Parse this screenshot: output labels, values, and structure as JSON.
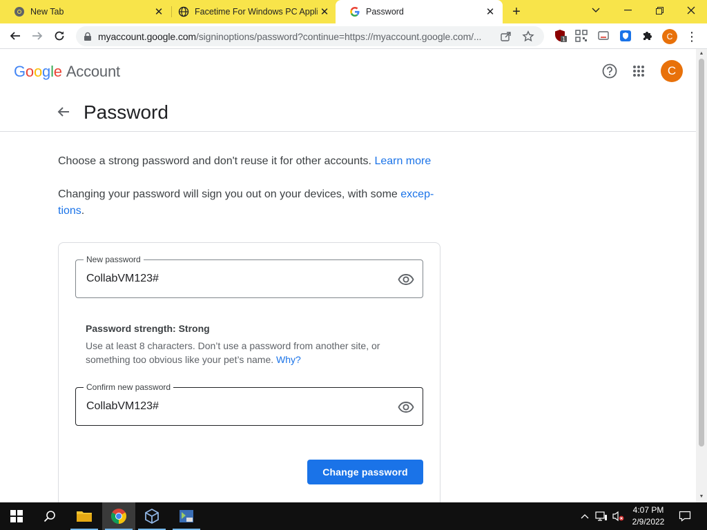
{
  "tabs": [
    {
      "title": "New Tab"
    },
    {
      "title": "Facetime For Windows PC Applic"
    },
    {
      "title": "Password"
    }
  ],
  "address_bar": {
    "host": "myaccount.google.com",
    "path": "/signinoptions/password?continue=https://myaccount.google.com/..."
  },
  "header": {
    "logo_letters": [
      "G",
      "o",
      "o",
      "g",
      "l",
      "e"
    ],
    "product": "Account",
    "avatar_letter": "C"
  },
  "page": {
    "title": "Password",
    "intro": "Choose a strong password and don't reuse it for other accounts.",
    "learn_more": "Learn more",
    "signout_note": "Changing your password will sign you out on your devices, with some",
    "exceptions_link_1": "excep-",
    "exceptions_link_2": "tions",
    "period": "."
  },
  "form": {
    "new_password_label": "New password",
    "new_password_value": "CollabVM123#",
    "strength_title": "Password strength: Strong",
    "strength_help": "Use at least 8 characters. Don’t use a password from another site, or something too obvious like your pet’s name.",
    "why_link": "Why?",
    "confirm_label": "Confirm new password",
    "confirm_value": "CollabVM123#",
    "submit": "Change password"
  },
  "taskbar": {
    "time": "4:07 PM",
    "date": "2/9/2022"
  },
  "colors": {
    "tabbar": "#f8e44a",
    "accent": "#1a73e8",
    "avatar": "#e8710a"
  }
}
